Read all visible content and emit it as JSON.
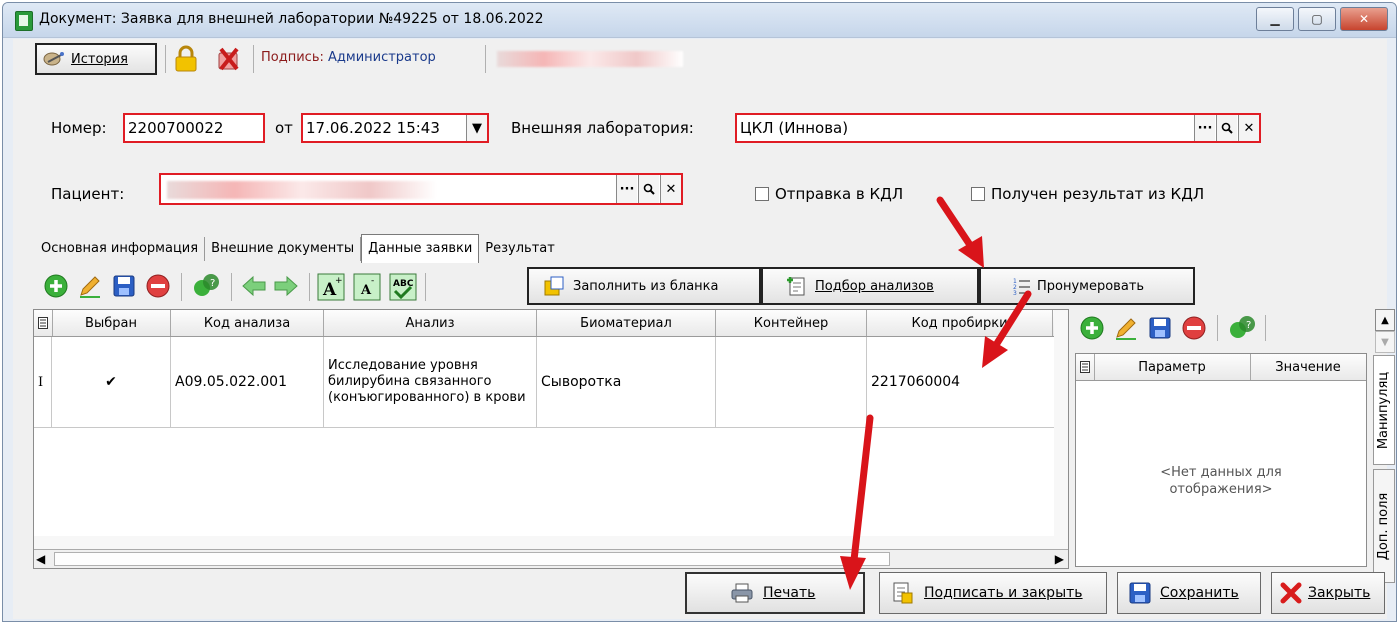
{
  "window": {
    "title": "Документ: Заявка для внешней лаборатории №49225 от 18.06.2022",
    "minimize_glyph": "▁",
    "maximize_glyph": "▢",
    "close_glyph": "✕"
  },
  "toolbar": {
    "history_label": "История",
    "signature_label": "Подпись:",
    "signature_value": "Администратор"
  },
  "form": {
    "number_label": "Номер:",
    "number_value": "2200700022",
    "date_label": "от",
    "date_value": "17.06.2022 15:43",
    "lab_label": "Внешняя лаборатория:",
    "lab_value": "ЦКЛ (Иннова)",
    "patient_label": "Пациент:",
    "send_kdl_label": "Отправка в КДЛ",
    "result_kdl_label": "Получен результат из КДЛ",
    "ellipsis": "···",
    "search_glyph": "🔍",
    "clear_glyph": "✕"
  },
  "tabs": [
    "Основная информация",
    "Внешние документы",
    "Данные заявки",
    "Результат"
  ],
  "actions": {
    "fill_from_form": "Заполнить из бланка",
    "select_tests": "Подбор анализов",
    "enumerate": "Пронумеровать"
  },
  "grid": {
    "columns": [
      "Выбран",
      "Код анализа",
      "Анализ",
      "Биоматериал",
      "Контейнер",
      "Код пробирки"
    ],
    "rows": [
      {
        "selected": "✔",
        "code": "A09.05.022.001",
        "analysis": "Исследование уровня билирубина связанного (конъюгированного) в крови",
        "biomaterial": "Сыворотка",
        "container": "",
        "tube_code": "2217060004"
      }
    ]
  },
  "params": {
    "columns": [
      "Параметр",
      "Значение"
    ],
    "empty_text": "<Нет данных для отображения>"
  },
  "side_tabs": [
    "Манипуляц",
    "Доп. поля"
  ],
  "bottom": {
    "print": "Печать",
    "sign_close": "Подписать и закрыть",
    "save": "Сохранить",
    "close": "Закрыть"
  },
  "colors": {
    "required_border": "#e01c24",
    "annotation_arrow": "#d9141a"
  }
}
